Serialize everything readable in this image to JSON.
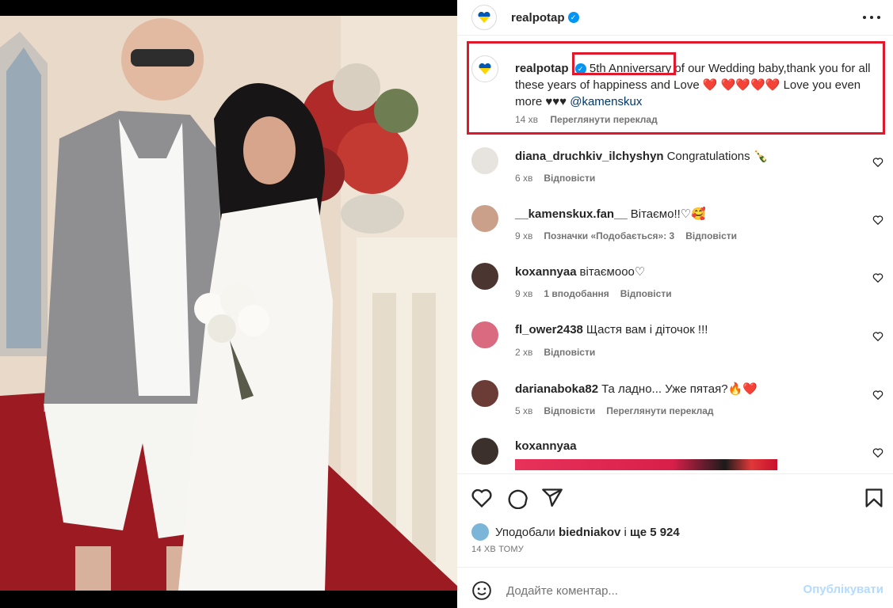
{
  "post": {
    "author": "realpotap",
    "verified_badge": "✓"
  },
  "caption": {
    "user": "realpotap",
    "text_before_highlight": "",
    "highlight": "5th Anniversary",
    "text_after_highlight": " of our Wedding baby,thank you for all these years of happiness and Love",
    "hearts": "❤️ ❤️❤️❤️❤️",
    "text_tail": "Love you even more ♥♥♥",
    "mention": "@kamenskux",
    "time": "14 хв",
    "translate": "Переглянути переклад"
  },
  "comments": [
    {
      "user": "diana_druchkiv_ilchyshyn",
      "text": "Congratulations 🍾",
      "time": "6 хв",
      "likes": "",
      "reply": "Відповісти",
      "translate": ""
    },
    {
      "user": "__kamenskux.fan__",
      "text": "Вітаємо!!♡🥰",
      "time": "9 хв",
      "likes": "Позначки «Подобається»: 3",
      "reply": "Відповісти",
      "translate": ""
    },
    {
      "user": "koxannyaa",
      "text": "вітаємооо♡",
      "time": "9 хв",
      "likes": "1 вподобання",
      "reply": "Відповісти",
      "translate": ""
    },
    {
      "user": "fl_ower2438",
      "text": "Щастя вам і діточок !!!",
      "time": "2 хв",
      "likes": "",
      "reply": "Відповісти",
      "translate": ""
    },
    {
      "user": "darianaboka82",
      "text": "Та ладно... Уже пятая?🔥❤️",
      "time": "5 хв",
      "likes": "",
      "reply": "Відповісти",
      "translate": "Переглянути переклад"
    },
    {
      "user": "koxannyaa",
      "text": "",
      "time": "",
      "likes": "",
      "reply": "",
      "translate": ""
    }
  ],
  "likes_line": {
    "prefix": "Уподобали",
    "user": "biedniakov",
    "middle": "і",
    "count": "ще 5 924"
  },
  "time_ago": "14 ХВ ТОМУ",
  "add_comment": {
    "placeholder": "Додайте коментар...",
    "post_label": "Опублікувати"
  },
  "icons": [
    "ukraine-heart-icon",
    "verified-icon",
    "more-icon",
    "heart-icon",
    "comment-icon",
    "share-icon",
    "bookmark-icon",
    "emoji-icon"
  ],
  "colors": {
    "accent": "#0095f6",
    "highlight_box": "#e0182b",
    "post_disabled": "#b3dbff"
  }
}
